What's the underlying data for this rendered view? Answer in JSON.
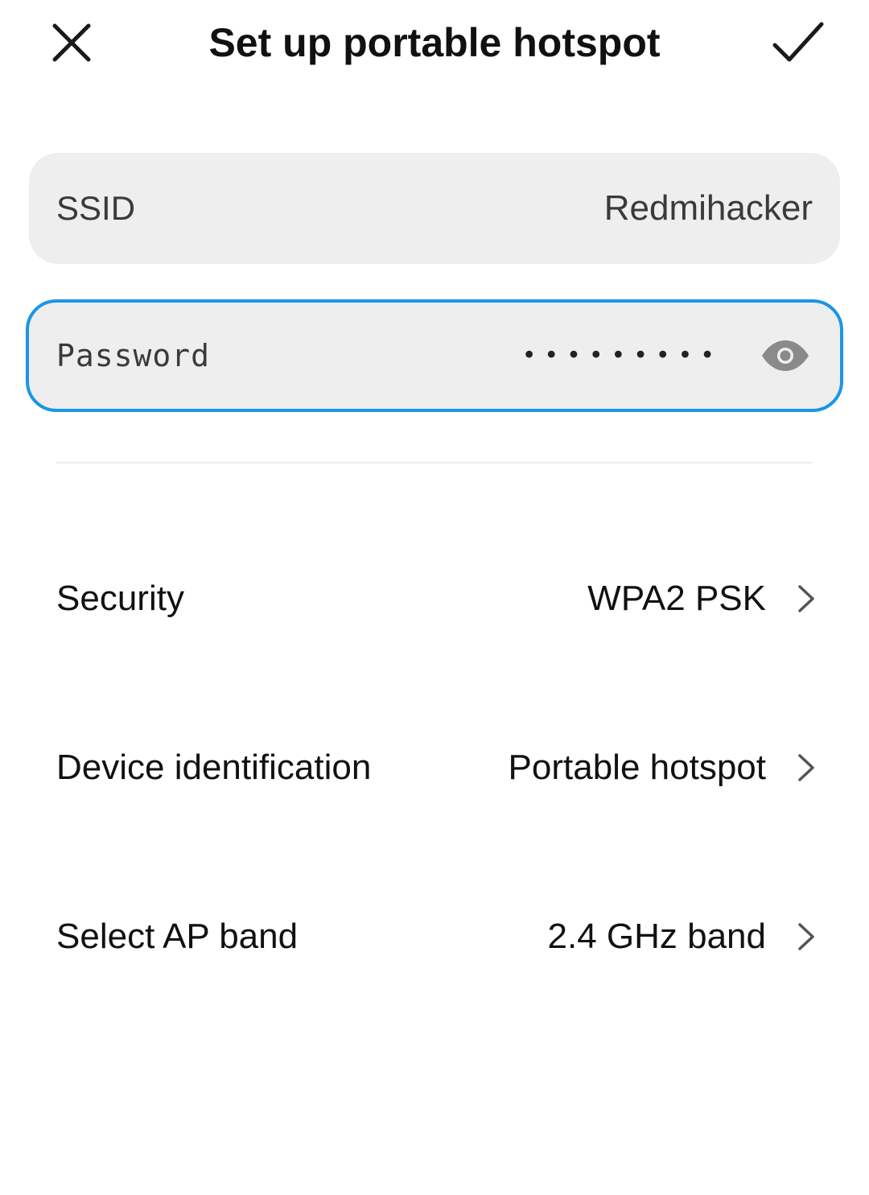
{
  "header": {
    "title": "Set up portable hotspot",
    "close_icon": "close-icon",
    "confirm_icon": "checkmark-icon"
  },
  "ssid": {
    "label": "SSID",
    "value": "Redmihacker"
  },
  "password": {
    "label": "Password",
    "masked_value": "•••••••••",
    "toggle_icon": "eye-icon",
    "focus_color": "#1a96e6"
  },
  "settings": [
    {
      "label": "Security",
      "value": "WPA2 PSK"
    },
    {
      "label": "Device identification",
      "value": "Portable hotspot"
    },
    {
      "label": "Select AP band",
      "value": "2.4 GHz band"
    }
  ],
  "colors": {
    "field_background": "#eeeeee",
    "accent": "#1a96e6",
    "text": "#111111"
  }
}
